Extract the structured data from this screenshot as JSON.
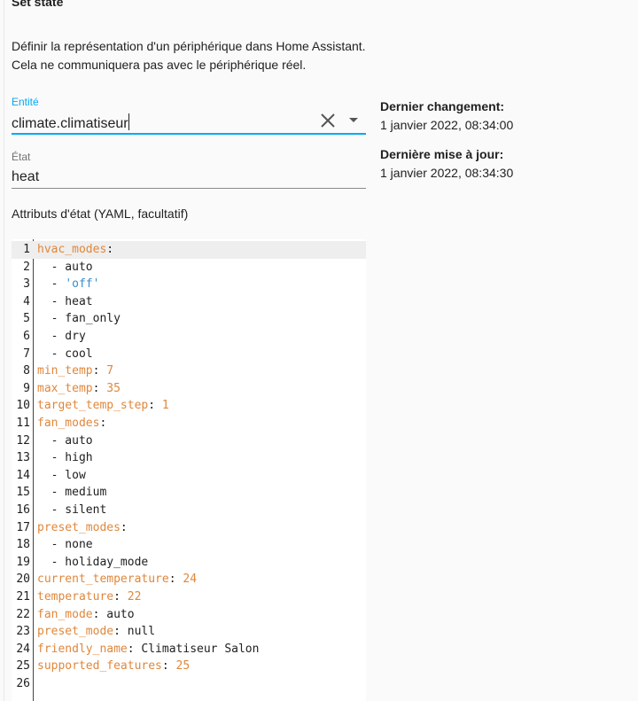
{
  "panel": {
    "title": "Set state",
    "description_1": "Définir la représentation d'un périphérique dans Home Assistant.",
    "description_2": "Cela ne communiquera pas avec le périphérique réel."
  },
  "entity_field": {
    "label": "Entité",
    "value": "climate.climatiseur"
  },
  "state_field": {
    "label": "État",
    "value": "heat"
  },
  "info": {
    "last_changed_label": "Dernier changement:",
    "last_changed_value": "1 janvier 2022, 08:34:00",
    "last_updated_label": "Dernière mise à jour:",
    "last_updated_value": "1 janvier 2022, 08:34:30"
  },
  "attributes": {
    "label": "Attributs d'état (YAML, facultatif)",
    "lines": [
      "hvac_modes:",
      "  - auto",
      "  - 'off'",
      "  - heat",
      "  - fan_only",
      "  - dry",
      "  - cool",
      "min_temp: 7",
      "max_temp: 35",
      "target_temp_step: 1",
      "fan_modes:",
      "  - auto",
      "  - high",
      "  - low",
      "  - medium",
      "  - silent",
      "preset_modes:",
      "  - none",
      "  - holiday_mode",
      "current_temperature: 24",
      "temperature: 22",
      "fan_mode: auto",
      "preset_mode: null",
      "friendly_name: Climatiseur Salon",
      "supported_features: 25",
      ""
    ]
  },
  "colors": {
    "accent": "#03a9f4",
    "yaml_key": "#e0873b",
    "yaml_string": "#3a8cc9"
  },
  "icons": {
    "clear": "close-icon",
    "dropdown": "menu-down-icon"
  }
}
